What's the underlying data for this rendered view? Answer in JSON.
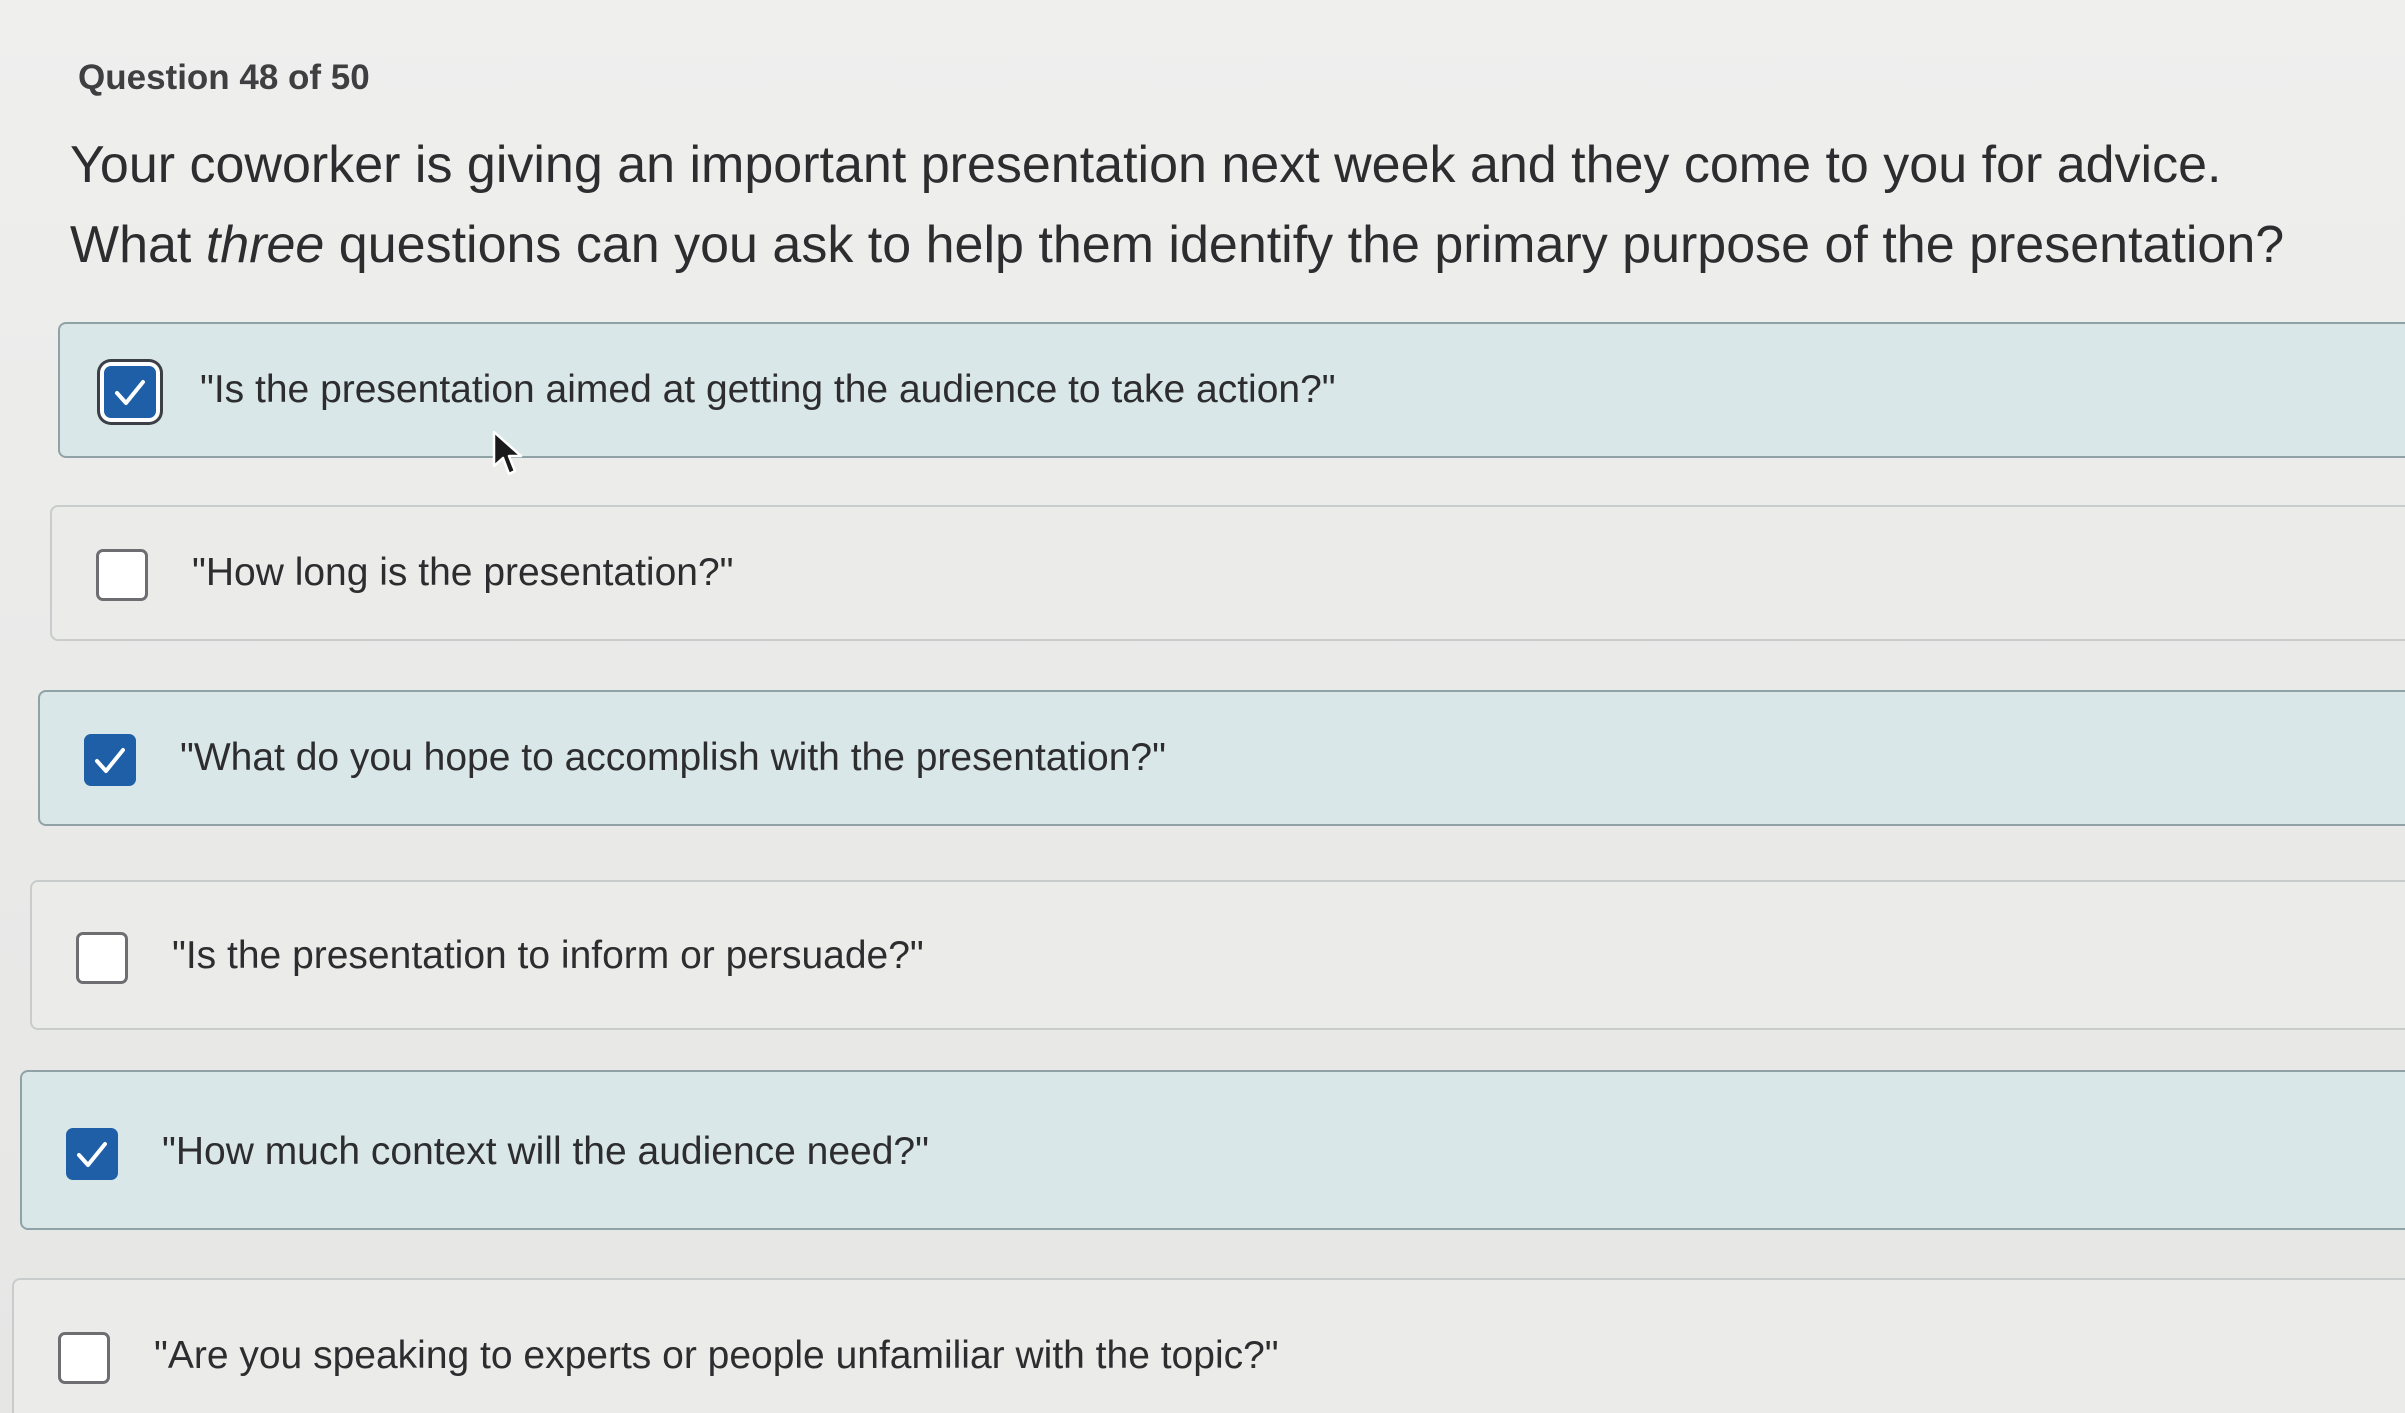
{
  "header": {
    "counter": "Question 48 of 50"
  },
  "question": {
    "line1": "Your coworker is giving an important presentation next week and they come to you for advice.",
    "line2_before": "What ",
    "line2_emphasis": "three",
    "line2_after": " questions can you ask to help them identify the primary purpose of the presentation?"
  },
  "options": [
    {
      "label": "\"Is the presentation aimed at getting the audience to take action?\"",
      "checked": true
    },
    {
      "label": "\"How long is the presentation?\"",
      "checked": false
    },
    {
      "label": "\"What do you hope to accomplish with the presentation?\"",
      "checked": true
    },
    {
      "label": "\"Is the presentation to inform or persuade?\"",
      "checked": false
    },
    {
      "label": "\"How much context will the audience need?\"",
      "checked": true
    },
    {
      "label": "\"Are you speaking to experts or people unfamiliar with the topic?\"",
      "checked": false
    }
  ],
  "colors": {
    "selected_bg": "#d9e7e8",
    "checkbox_checked": "#1e5fa8",
    "unselected_bg": "#ebebea"
  },
  "icons": {
    "checkmark": "checkmark-icon",
    "cursor": "mouse-pointer-icon"
  }
}
